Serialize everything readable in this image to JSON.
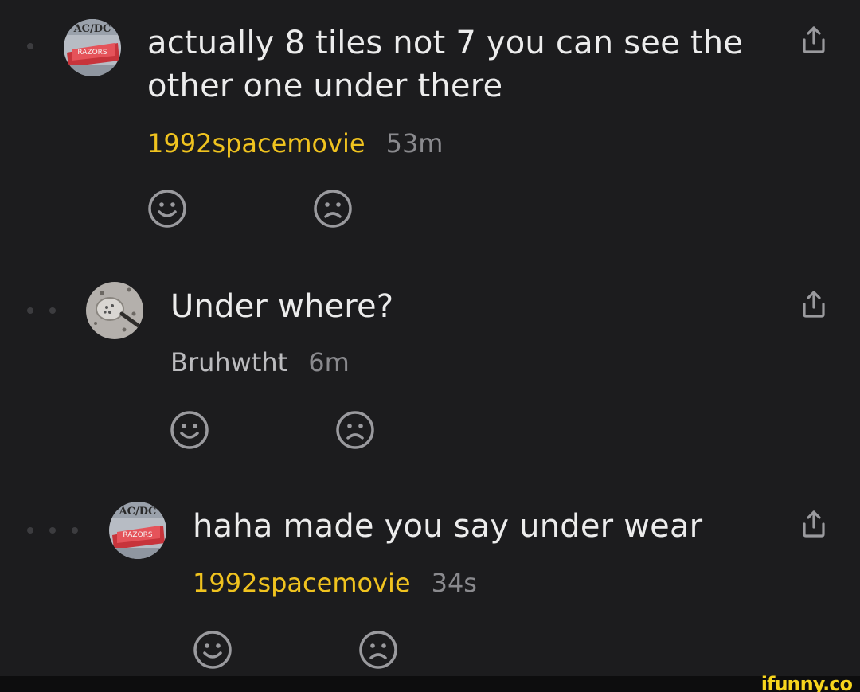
{
  "comments": [
    {
      "depth": 1,
      "text": "actually 8 tiles not 7 you can see the other one under there",
      "username": "1992spacemovie",
      "time": "53m",
      "avatar": "acdc-razors-edge-album-avatar",
      "username_color": "#f0c31f"
    },
    {
      "depth": 2,
      "text": "Under where?",
      "username": "Bruhwtht",
      "time": "6m",
      "avatar": "spoon-photo-avatar",
      "username_color": "#bcbcbf"
    },
    {
      "depth": 3,
      "text": "haha made you say under wear",
      "username": "1992spacemovie",
      "time": "34s",
      "avatar": "acdc-razors-edge-album-avatar",
      "username_color": "#f0c31f"
    }
  ],
  "icons": {
    "smile": "smile-icon",
    "frown": "frown-icon",
    "share": "share-icon"
  },
  "watermark": "ifunny.co",
  "colors": {
    "background": "#1c1c1e",
    "text": "#ececec",
    "gold_username": "#f0c31f",
    "muted": "#8a8a8e",
    "icon": "#9a9a9e",
    "watermark": "#f7d51d"
  }
}
